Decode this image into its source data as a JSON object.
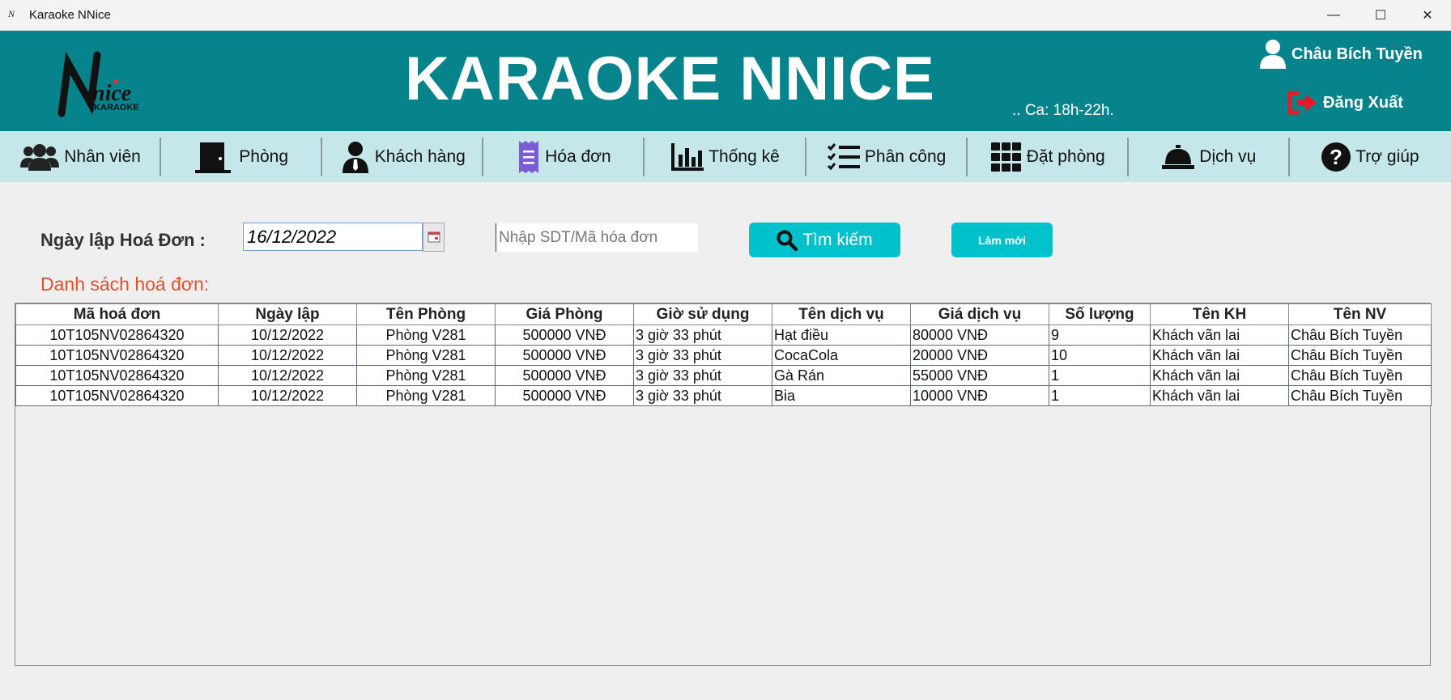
{
  "window": {
    "title": "Karaoke NNice"
  },
  "header": {
    "brand": "KARAOKE NNICE",
    "logo_text": "Nnice KARAOKE",
    "user_name": "Châu Bích Tuyền",
    "shift": ".. Ca: 18h-22h.",
    "logout_label": "Đăng Xuất"
  },
  "nav": {
    "items": [
      {
        "label": "Nhân viên",
        "icon": "users-icon"
      },
      {
        "label": "Phòng",
        "icon": "door-icon"
      },
      {
        "label": "Khách hàng",
        "icon": "customer-icon"
      },
      {
        "label": "Hóa đơn",
        "icon": "receipt-icon"
      },
      {
        "label": "Thống kê",
        "icon": "chart-icon"
      },
      {
        "label": "Phân công",
        "icon": "checklist-icon"
      },
      {
        "label": "Đặt phòng",
        "icon": "grid-icon"
      },
      {
        "label": "Dịch vụ",
        "icon": "service-bell-icon"
      },
      {
        "label": "Trợ giúp",
        "icon": "help-icon"
      }
    ]
  },
  "filter": {
    "date_label": "Ngày lập Hoá Đơn :",
    "date_value": "16/12/2022",
    "search_placeholder": "Nhập SDT/Mã hóa đơn",
    "find_label": "Tìm kiếm",
    "reset_label": "Làm mới"
  },
  "list": {
    "title": "Danh sách hoá đơn:",
    "columns": [
      "Mã hoá đơn",
      "Ngày lập",
      "Tên Phòng",
      "Giá Phòng",
      "Giờ sử dụng",
      "Tên dịch vụ",
      "Giá dịch vụ",
      "Số lượng",
      "Tên KH",
      "Tên NV"
    ],
    "rows": [
      [
        "10T105NV02864320",
        "10/12/2022",
        "Phòng V281",
        "500000 VNĐ",
        "3 giờ 33 phút",
        "Hạt điều",
        "80000 VNĐ",
        "9",
        "Khách vãn lai",
        "Châu Bích Tuyền"
      ],
      [
        "10T105NV02864320",
        "10/12/2022",
        "Phòng V281",
        "500000 VNĐ",
        "3 giờ 33 phút",
        "CocaCola",
        "20000 VNĐ",
        "10",
        "Khách vãn lai",
        "Châu Bích Tuyền"
      ],
      [
        "10T105NV02864320",
        "10/12/2022",
        "Phòng V281",
        "500000 VNĐ",
        "3 giờ 33 phút",
        "Gà Rán",
        "55000 VNĐ",
        "1",
        "Khách vãn lai",
        "Châu Bích Tuyền"
      ],
      [
        "10T105NV02864320",
        "10/12/2022",
        "Phòng V281",
        "500000 VNĐ",
        "3 giờ 33 phút",
        "Bia",
        "10000 VNĐ",
        "1",
        "Khách vãn lai",
        "Châu Bích Tuyền"
      ]
    ]
  },
  "colors": {
    "header_bg": "#07838b",
    "nav_bg": "#c6e7ea",
    "button_bg": "#00c1cc",
    "list_title": "#e0502b"
  }
}
